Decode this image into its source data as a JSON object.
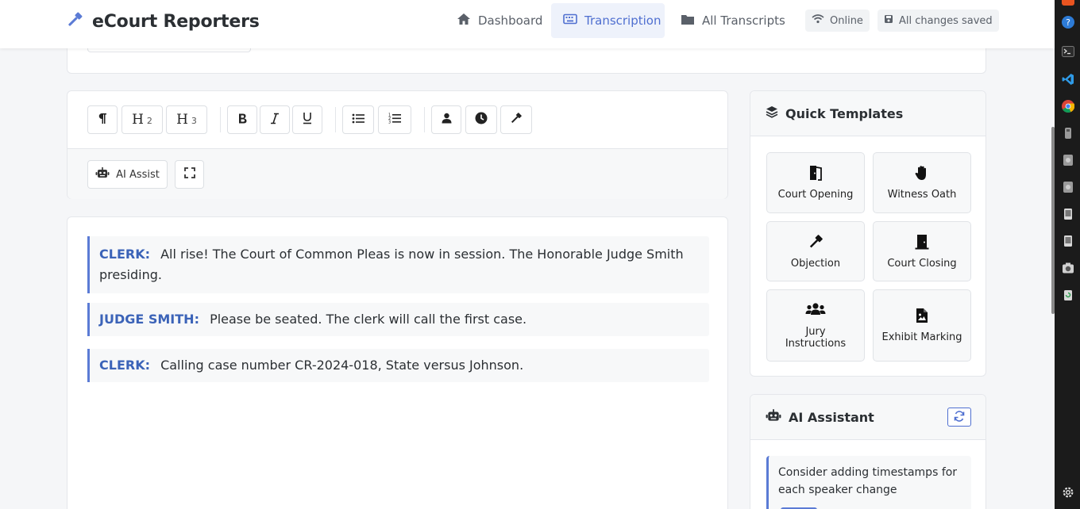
{
  "app": {
    "title": "eCourt Reporters",
    "accent_color": "#4f6fd0"
  },
  "nav": {
    "items": [
      {
        "label": "Dashboard",
        "icon": "home-icon"
      },
      {
        "label": "Transcription",
        "icon": "keyboard-icon",
        "active": true
      },
      {
        "label": "All Transcripts",
        "icon": "folder-icon"
      }
    ],
    "status_online": "Online",
    "status_saved": "All changes saved"
  },
  "toolbar": {
    "paragraph": "paragraph-icon",
    "h2": {
      "letter": "H",
      "level": "2"
    },
    "h3": {
      "letter": "H",
      "level": "3"
    },
    "bold": "bold-icon",
    "italic": "italic-icon",
    "underline": "underline-icon",
    "bullet_list": "list-ul-icon",
    "numbered_list": "list-ol-icon",
    "speaker": "user-icon",
    "timestamp": "clock-icon",
    "gavel": "gavel-icon",
    "ai_assist_label": "AI Assist",
    "fullscreen": "expand-icon"
  },
  "transcript": [
    {
      "speaker": "CLERK:",
      "text": "All rise! The Court of Common Pleas is now in session. The Honorable Judge Smith presiding."
    },
    {
      "speaker": "JUDGE SMITH:",
      "text": "Please be seated. The clerk will call the first case."
    },
    {
      "speaker": "CLERK:",
      "text": "Calling case number CR-2024-018, State versus Johnson."
    }
  ],
  "templates": {
    "title": "Quick Templates",
    "items": [
      {
        "label": "Court Opening",
        "icon": "door-open-icon"
      },
      {
        "label": "Witness Oath",
        "icon": "hand-icon"
      },
      {
        "label": "Objection",
        "icon": "gavel-icon"
      },
      {
        "label": "Court Closing",
        "icon": "door-closed-icon"
      },
      {
        "label": "Jury Instructions",
        "icon": "users-icon"
      },
      {
        "label": "Exhibit Marking",
        "icon": "file-image-icon"
      }
    ]
  },
  "ai_assistant": {
    "title": "AI Assistant",
    "tip": "Consider adding timestamps for each speaker change"
  }
}
